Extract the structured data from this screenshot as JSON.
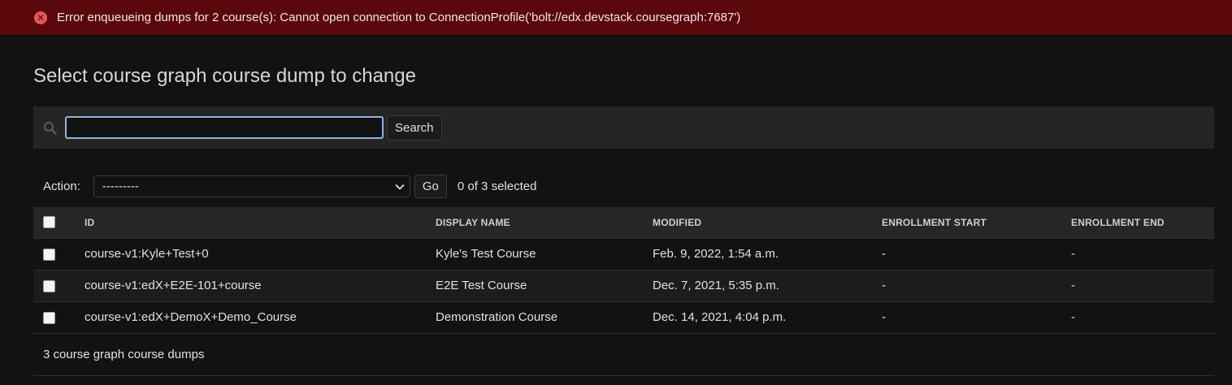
{
  "messages": {
    "error": "Error enqueueing dumps for 2 course(s): Cannot open connection to ConnectionProfile('bolt://edx.devstack.coursegraph:7687')"
  },
  "page_title": "Select course graph course dump to change",
  "search": {
    "value": "",
    "button_label": "Search"
  },
  "actions": {
    "label": "Action:",
    "selected_option": "---------",
    "go_label": "Go",
    "selection_count": "0 of 3 selected"
  },
  "table": {
    "headers": [
      "ID",
      "DISPLAY NAME",
      "MODIFIED",
      "ENROLLMENT START",
      "ENROLLMENT END"
    ],
    "rows": [
      {
        "id": "course-v1:Kyle+Test+0",
        "display_name": "Kyle's Test Course",
        "modified": "Feb. 9, 2022, 1:54 a.m.",
        "enrollment_start": "-",
        "enrollment_end": "-"
      },
      {
        "id": "course-v1:edX+E2E-101+course",
        "display_name": "E2E Test Course",
        "modified": "Dec. 7, 2021, 5:35 p.m.",
        "enrollment_start": "-",
        "enrollment_end": "-"
      },
      {
        "id": "course-v1:edX+DemoX+Demo_Course",
        "display_name": "Demonstration Course",
        "modified": "Dec. 14, 2021, 4:04 p.m.",
        "enrollment_start": "-",
        "enrollment_end": "-"
      }
    ]
  },
  "footer": {
    "result_count": "3 course graph course dumps"
  },
  "icons": {
    "error": "error-circle-icon",
    "search": "search-icon",
    "dropdown": "chevron-down-icon"
  },
  "colors": {
    "error_background": "#5a080b",
    "page_background": "#121212",
    "focus_outline": "#8fb3dc"
  }
}
